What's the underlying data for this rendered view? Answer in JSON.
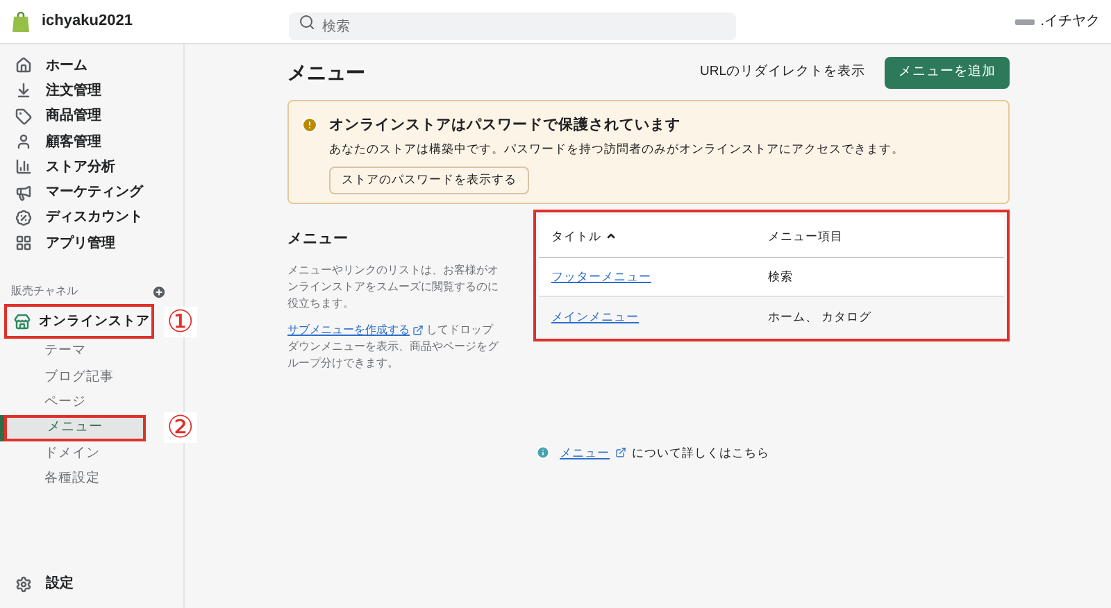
{
  "topbar": {
    "store_name": "ichyaku2021",
    "search": {
      "placeholder": "検索"
    },
    "account": ".イチヤク"
  },
  "sidebar": {
    "items": [
      {
        "label": "ホーム"
      },
      {
        "label": "注文管理"
      },
      {
        "label": "商品管理"
      },
      {
        "label": "顧客管理"
      },
      {
        "label": "ストア分析"
      },
      {
        "label": "マーケティング"
      },
      {
        "label": "ディスカウント"
      },
      {
        "label": "アプリ管理"
      }
    ],
    "channels_heading": "販売チャネル",
    "channel": {
      "label": "オンラインストア",
      "annotation": "①"
    },
    "sub_items": [
      {
        "label": "テーマ",
        "selected": false
      },
      {
        "label": "ブログ記事",
        "selected": false
      },
      {
        "label": "ページ",
        "selected": false
      },
      {
        "label": "メニュー",
        "selected": true,
        "annotation": "②"
      },
      {
        "label": "ドメイン",
        "selected": false
      },
      {
        "label": "各種設定",
        "selected": false
      }
    ],
    "settings": "設定"
  },
  "page": {
    "title": "メニュー",
    "redirect_link": "URLのリダイレクトを表示",
    "add_button": "メニューを追加"
  },
  "banner": {
    "title": "オンラインストアはパスワードで保護されています",
    "text": "あなたのストアは構築中です。パスワードを持つ訪問者のみがオンラインストアにアクセスできます。",
    "button": "ストアのパスワードを表示する"
  },
  "section": {
    "title": "メニュー",
    "description": "メニューやリンクのリストは、お客様がオンラインストアをスムーズに閲覧するのに役立ちます。",
    "link": "サブメニューを作成する",
    "link_text": "してドロップダウンメニューを表示、商品やページをグループ分けできます。"
  },
  "table": {
    "highlighted": true,
    "columns": [
      "タイトル",
      "メニュー項目"
    ],
    "rows": [
      {
        "title": "フッターメニュー",
        "items": "検索"
      },
      {
        "title": "メインメニュー",
        "items": "ホーム、 カタログ"
      }
    ]
  },
  "footer": {
    "link": "メニュー",
    "text": "について詳しくはこちら"
  }
}
